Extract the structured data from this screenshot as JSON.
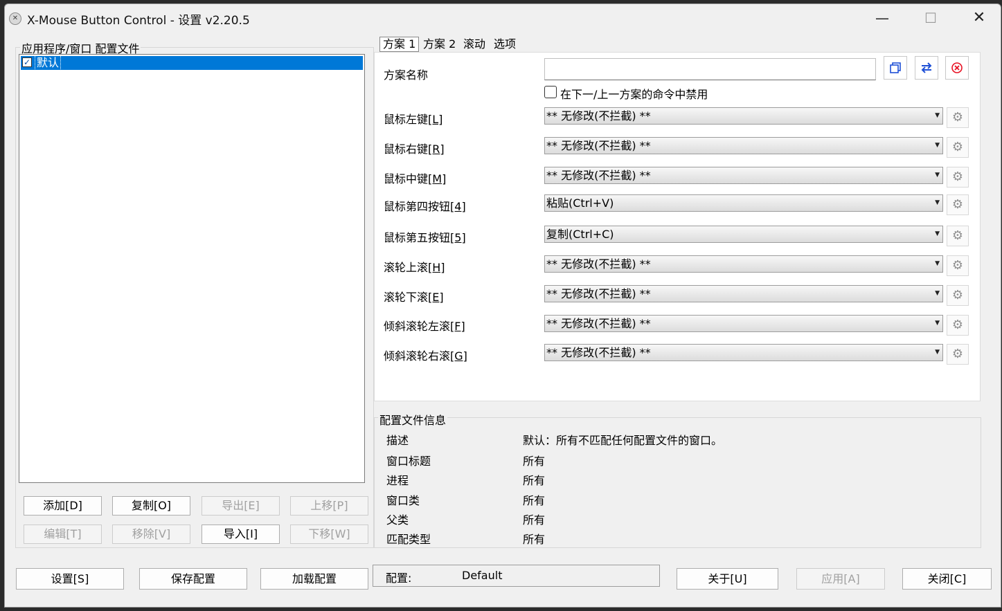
{
  "window": {
    "title": "X-Mouse Button Control - 设置 v2.20.5",
    "min_glyph": "—",
    "max_glyph": "☐",
    "close_glyph": "✕"
  },
  "profiles": {
    "group_title": "应用程序/窗口 配置文件",
    "items": [
      {
        "label": "默认",
        "checked": true
      }
    ],
    "buttons": {
      "add": "添加[D]",
      "copy": "复制[O]",
      "export": "导出[E]",
      "move_up": "上移[P]",
      "edit": "编辑[T]",
      "remove": "移除[V]",
      "import": "导入[I]",
      "move_down": "下移[W]"
    }
  },
  "tabs": [
    "方案 1",
    "方案 2",
    "滚动",
    "选项"
  ],
  "scheme": {
    "name_label": "方案名称",
    "name_value": "",
    "disable_label": "在下一/上一方案的命令中禁用",
    "rows": [
      {
        "label": "鼠标左键",
        "key": "[L]",
        "value": "** 无修改(不拦截) **"
      },
      {
        "label": "鼠标右键",
        "key": "[R]",
        "value": "** 无修改(不拦截) **"
      },
      {
        "label": "鼠标中键",
        "key": "[M]",
        "value": "** 无修改(不拦截) **"
      },
      {
        "label": "鼠标第四按钮",
        "key": "[4]",
        "value": "粘贴(Ctrl+V)"
      },
      {
        "label": "鼠标第五按钮",
        "key": "[5]",
        "value": "复制(Ctrl+C)"
      },
      {
        "label": "滚轮上滚",
        "key": "[H]",
        "value": "** 无修改(不拦截) **"
      },
      {
        "label": "滚轮下滚",
        "key": "[E]",
        "value": "** 无修改(不拦截) **"
      },
      {
        "label": "倾斜滚轮左滚",
        "key": "[F]",
        "value": "** 无修改(不拦截) **"
      },
      {
        "label": "倾斜滚轮右滚",
        "key": "[G]",
        "value": "** 无修改(不拦截) **"
      }
    ]
  },
  "profile_info": {
    "group_title": "配置文件信息",
    "rows": [
      {
        "label": "描述",
        "value": "默认：所有不匹配任何配置文件的窗口。"
      },
      {
        "label": "窗口标题",
        "value": "所有"
      },
      {
        "label": "进程",
        "value": "所有"
      },
      {
        "label": "窗口类",
        "value": "所有"
      },
      {
        "label": "父类",
        "value": "所有"
      },
      {
        "label": "匹配类型",
        "value": "所有"
      }
    ]
  },
  "footer": {
    "settings": "设置[S]",
    "save": "保存配置",
    "load": "加载配置",
    "config_label": "配置:",
    "config_value": "Default",
    "about": "关于[U]",
    "apply": "应用[A]",
    "close": "关闭[C]"
  },
  "colors": {
    "selection": "#0078d7",
    "close_icon": "#e81123",
    "swap_icon": "#1e4fd6"
  }
}
